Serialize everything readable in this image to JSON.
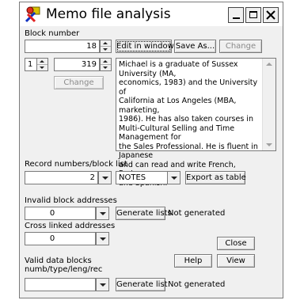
{
  "window": {
    "title": "Memo file analysis",
    "minimize_label": "_",
    "close_label": "✕"
  },
  "block": {
    "label": "Block number",
    "number": "18",
    "edit_button": "Edit in window",
    "save_button": "Save As...",
    "change_button": "Change"
  },
  "record": {
    "from": "1",
    "to": "319",
    "change_button": "Change"
  },
  "memo": {
    "text": "Michael is a graduate of Sussex University (MA,\neconomics, 1983) and the University of\nCalifornia at Los Angeles (MBA, marketing,\n1986). He has also taken courses in\nMulti-Cultural Selling and Time Management for\nthe Sales Professional. He is fluent in Japanese\nand can read and write French, Portuguese,\nand Spanish."
  },
  "record_list": {
    "label": "Record numbers/block list",
    "number_value": "2",
    "field_value": "NOTES",
    "export_button": "Export as table"
  },
  "invalid": {
    "label": "Invalid block addresses",
    "value": "0",
    "generate_button": "Generate lists",
    "status": "Not generated"
  },
  "cross": {
    "label": "Cross linked addresses",
    "value": "0",
    "close_button": "Close"
  },
  "valid": {
    "label_line1": "Valid data blocks",
    "label_line2": "numb/type/leng/rec",
    "value": "",
    "help_button": "Help",
    "view_button": "View",
    "generate_button": "Generate list",
    "status": "Not generated"
  }
}
